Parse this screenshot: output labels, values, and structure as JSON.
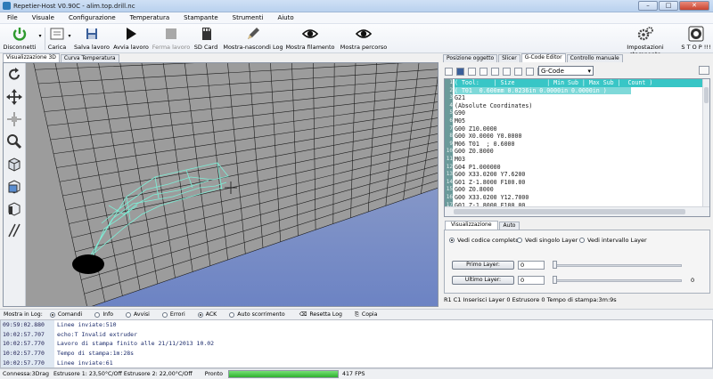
{
  "window": {
    "title": "Repetier-Host V0.90C - alim.top.drill.nc",
    "minimize": "–",
    "maximize": "□",
    "close": "✕"
  },
  "menu": [
    "File",
    "Visuale",
    "Configurazione",
    "Temperatura",
    "Stampante",
    "Strumenti",
    "Aiuto"
  ],
  "toolbar": {
    "disconnect": "Disconnetti",
    "load": "Carica",
    "save": "Salva lavoro",
    "start": "Avvia lavoro",
    "stop": "Ferma lavoro",
    "sdcard": "SD Card",
    "toggle_log": "Mostra-nascondi Log",
    "show_filament": "Mostra filamento",
    "show_path": "Mostra percorso",
    "printer_settings": "Impostazioni stampante",
    "emergency": "S T O P !!!"
  },
  "left_tabs": [
    "Visualizzazione 3D",
    "Curva Temperatura"
  ],
  "right_tabs": [
    "Posizione oggetto",
    "Slicer",
    "G-Code Editor",
    "Controllo manuale"
  ],
  "gcode": {
    "selector": "G-Code",
    "lines": [
      "( Tool:    | Size         | Min Sub | Max Sub |  Count )",
      "( T01  0.600mm 0.0236in 0.0000in 0.0000in )",
      "G21",
      "(Absolute Coordinates)",
      "G90",
      "M05",
      "G00 Z10.0000",
      "G00 X0.0000 Y0.0000",
      "M06 T01  ; 0.6000",
      "G00 Z0.8000",
      "M03",
      "G04 P1.000000",
      "G00 X33.0200 Y7.6200",
      "G01 Z-1.8000 F100.00",
      "G00 Z0.8000",
      "G00 X33.0200 Y12.7000",
      "G01 Z-1.8000 F100.00"
    ],
    "numbers": [
      "1",
      "2",
      "3",
      "4",
      "5",
      "6",
      "7",
      "8",
      "9",
      "10",
      "11",
      "12",
      "13",
      "14",
      "15",
      "16",
      "17"
    ]
  },
  "vis": {
    "tabs": [
      "Visualizzazione",
      "Auto"
    ],
    "options": [
      "Vedi codice completo",
      "Vedi singolo Layer",
      "Vedi intervallo Layer"
    ],
    "first_layer": "Primo Layer:",
    "last_layer": "Ultimo Layer:",
    "first_value": "0",
    "last_value": "0",
    "slider_end": "0"
  },
  "editor_status": "R1   C1   Inserisci   Layer 0   Estrusore 0   Tempo di stampa:3m:9s",
  "logbar": {
    "label": "Mostra in Log:",
    "options": [
      "Comandi",
      "Info",
      "Avvisi",
      "Errori",
      "ACK",
      "Auto scorrimento"
    ],
    "reset": "Resetta Log",
    "copy": "Copia"
  },
  "log": [
    {
      "t": "09:59:02.880",
      "m": "Linee inviate:510"
    },
    {
      "t": "10:02:57.707",
      "m": "echo:T  Invalid extruder"
    },
    {
      "t": "10:02:57.770",
      "m": "Lavoro di stampa finito alle 21/11/2013 10.02"
    },
    {
      "t": "10:02:57.770",
      "m": "Tempo di stampa:1m:28s"
    },
    {
      "t": "10:02:57.770",
      "m": "Linee inviate:61"
    }
  ],
  "status": {
    "connection": "Connessa:3Drag",
    "temps": "Estrusore 1: 23,50°C/Off Estrusore 2: 22,00°C/Off",
    "ready": "Pronto",
    "fps": "417 FPS",
    "progress": 1.0
  },
  "colors": {
    "accent": "#38c6c6",
    "progress": "#2fb12f",
    "grid": "#1a1a1a"
  }
}
